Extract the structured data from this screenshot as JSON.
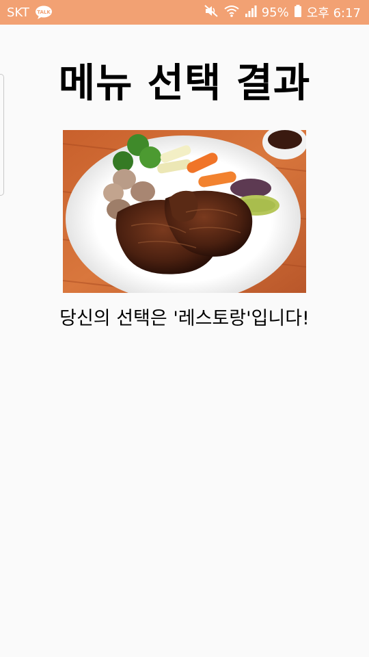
{
  "status_bar": {
    "carrier": "SKT",
    "battery": "95%",
    "time": "오후 6:17",
    "icons": [
      "talk-icon",
      "mute-icon",
      "wifi-icon",
      "signal-icon",
      "battery-icon"
    ]
  },
  "main": {
    "title": "메뉴 선택 결과",
    "image": {
      "subject": "steak-plate"
    },
    "result_text": "당신의 선택은 '레스토랑'입니다!"
  },
  "colors": {
    "status_bar_bg": "#f2a173",
    "background": "#fafafa",
    "text": "#000000"
  }
}
